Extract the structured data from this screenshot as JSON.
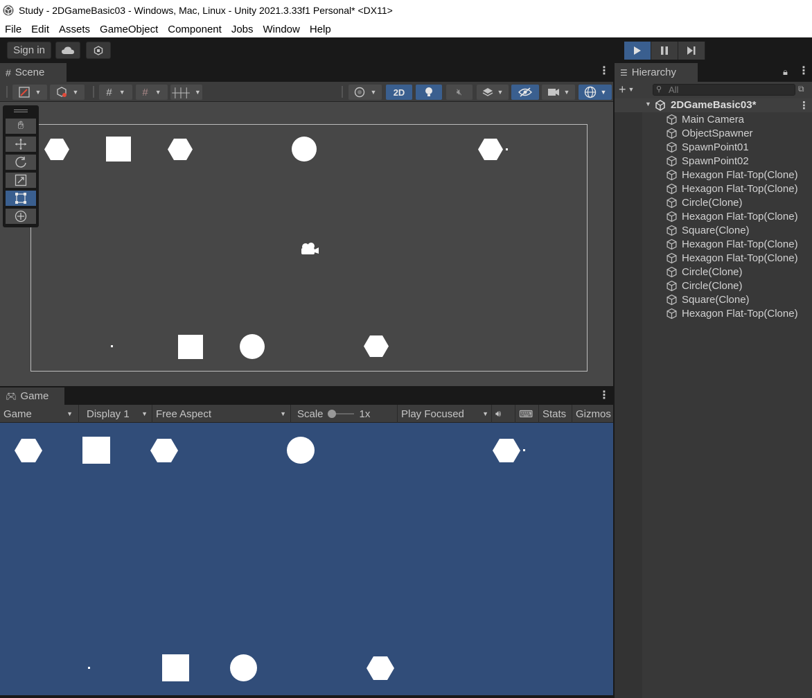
{
  "window": {
    "title": "Study - 2DGameBasic03 - Windows, Mac, Linux - Unity 2021.3.33f1 Personal* <DX11>"
  },
  "menu": [
    "File",
    "Edit",
    "Assets",
    "GameObject",
    "Component",
    "Jobs",
    "Window",
    "Help"
  ],
  "toolbar": {
    "sign_in": "Sign in"
  },
  "scene": {
    "tab_label": "Scene",
    "mode_2d": "2D"
  },
  "game": {
    "tab_label": "Game",
    "view_select": "Game",
    "display_select": "Display 1",
    "aspect_select": "Free Aspect",
    "scale_label": "Scale",
    "scale_value": "1x",
    "play_mode": "Play Focused",
    "stats": "Stats",
    "gizmos": "Gizmos"
  },
  "hierarchy": {
    "tab_label": "Hierarchy",
    "search_placeholder": "All",
    "scene_name": "2DGameBasic03*",
    "items": [
      "Main Camera",
      "ObjectSpawner",
      "SpawnPoint01",
      "SpawnPoint02",
      "Hexagon Flat-Top(Clone)",
      "Hexagon Flat-Top(Clone)",
      "Circle(Clone)",
      "Hexagon Flat-Top(Clone)",
      "Square(Clone)",
      "Hexagon Flat-Top(Clone)",
      "Hexagon Flat-Top(Clone)",
      "Circle(Clone)",
      "Circle(Clone)",
      "Square(Clone)",
      "Hexagon Flat-Top(Clone)"
    ]
  },
  "colors": {
    "accent": "#3a5f8f",
    "game_background": "#314d79",
    "scene_background": "#474747",
    "panel": "#3c3c3c"
  }
}
